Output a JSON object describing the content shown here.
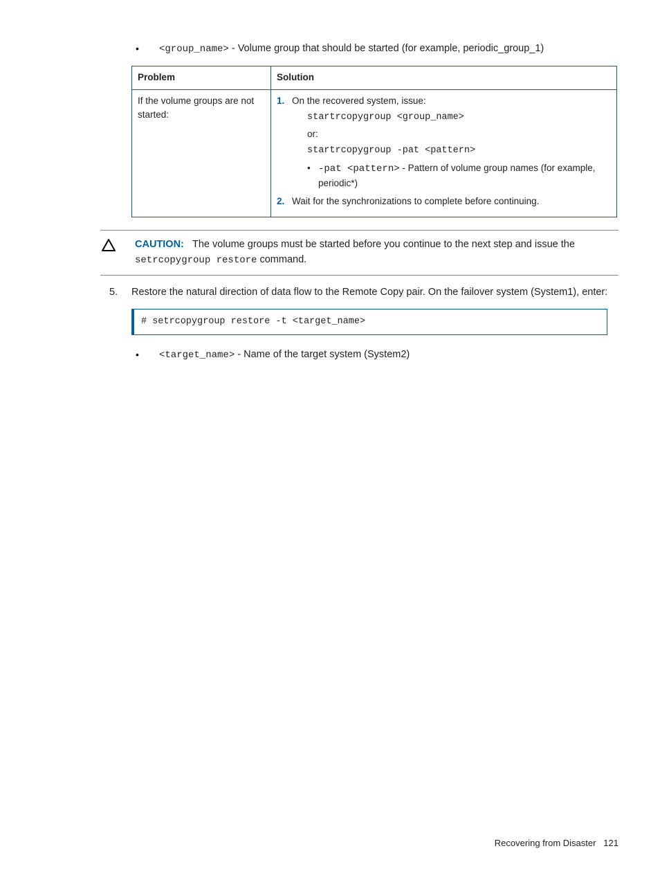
{
  "bullet_top": {
    "code": "<group_name>",
    "text": " - Volume group that should be started (for example, periodic_group_1)"
  },
  "table": {
    "headers": {
      "problem": "Problem",
      "solution": "Solution"
    },
    "row": {
      "problem": "If the volume groups are not started:",
      "step1_num": "1.",
      "step1_text": "On the recovered system, issue:",
      "step1_code1": "startrcopygroup <group_name>",
      "step1_or": "or:",
      "step1_code2": "startrcopygroup -pat <pattern>",
      "step1_inner_code": "-pat <pattern>",
      "step1_inner_text": " - Pattern of volume group names (for example, periodic*)",
      "step2_num": "2.",
      "step2_text": "Wait for the synchronizations to complete before continuing."
    }
  },
  "caution": {
    "label": "CAUTION:",
    "text_before": "The volume groups must be started before you continue to the next step and issue the ",
    "code": "setrcopygroup restore",
    "text_after": " command."
  },
  "step5": {
    "num": "5.",
    "text": "Restore the natural direction of data flow to the Remote Copy pair. On the failover system (System1), enter:",
    "codebox": "# setrcopygroup restore -t <target_name>",
    "bullet_code": "<target_name>",
    "bullet_text": " - Name of the target system (System2)"
  },
  "footer": {
    "section": "Recovering from Disaster",
    "page": "121"
  }
}
